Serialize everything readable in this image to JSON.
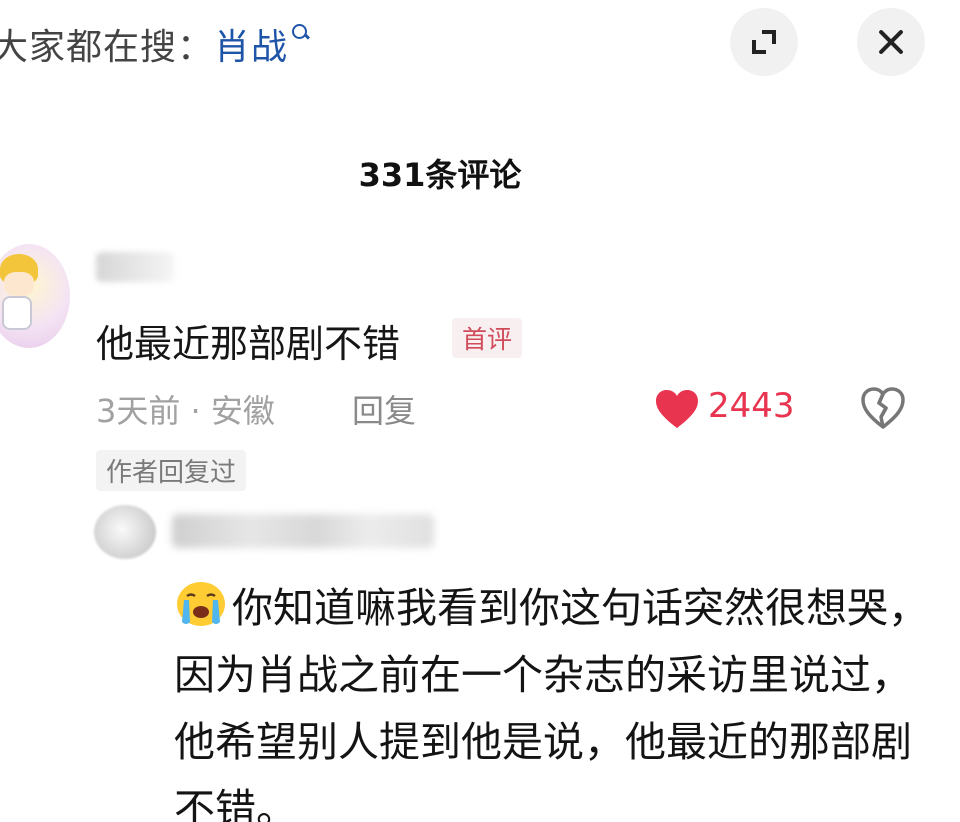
{
  "header": {
    "hot_search_prefix": "大家都在搜：",
    "hot_search_keyword": "肖战"
  },
  "comments_panel": {
    "count_title": "331条评论"
  },
  "comment": {
    "text": "他最近那部剧不错",
    "badge": "首评",
    "meta": "3天前 · 安徽",
    "reply_label": "回复",
    "likes": "2443",
    "author_replied": "作者回复过"
  },
  "reply": {
    "text": "你知道嘛我看到你这句话突然很想哭，因为肖战之前在一个杂志的采访里说过，他希望别人提到他是说，他最近的那部剧不错。"
  },
  "icons": {
    "search": "magnifier-icon",
    "expand": "expand-icon",
    "close": "close-icon",
    "like": "heart-icon",
    "dislike": "broken-heart-icon",
    "emoji": "crying-face-icon"
  },
  "colors": {
    "keyword": "#1f55a8",
    "like": "#e8344f",
    "badge": "#d14b5a"
  }
}
